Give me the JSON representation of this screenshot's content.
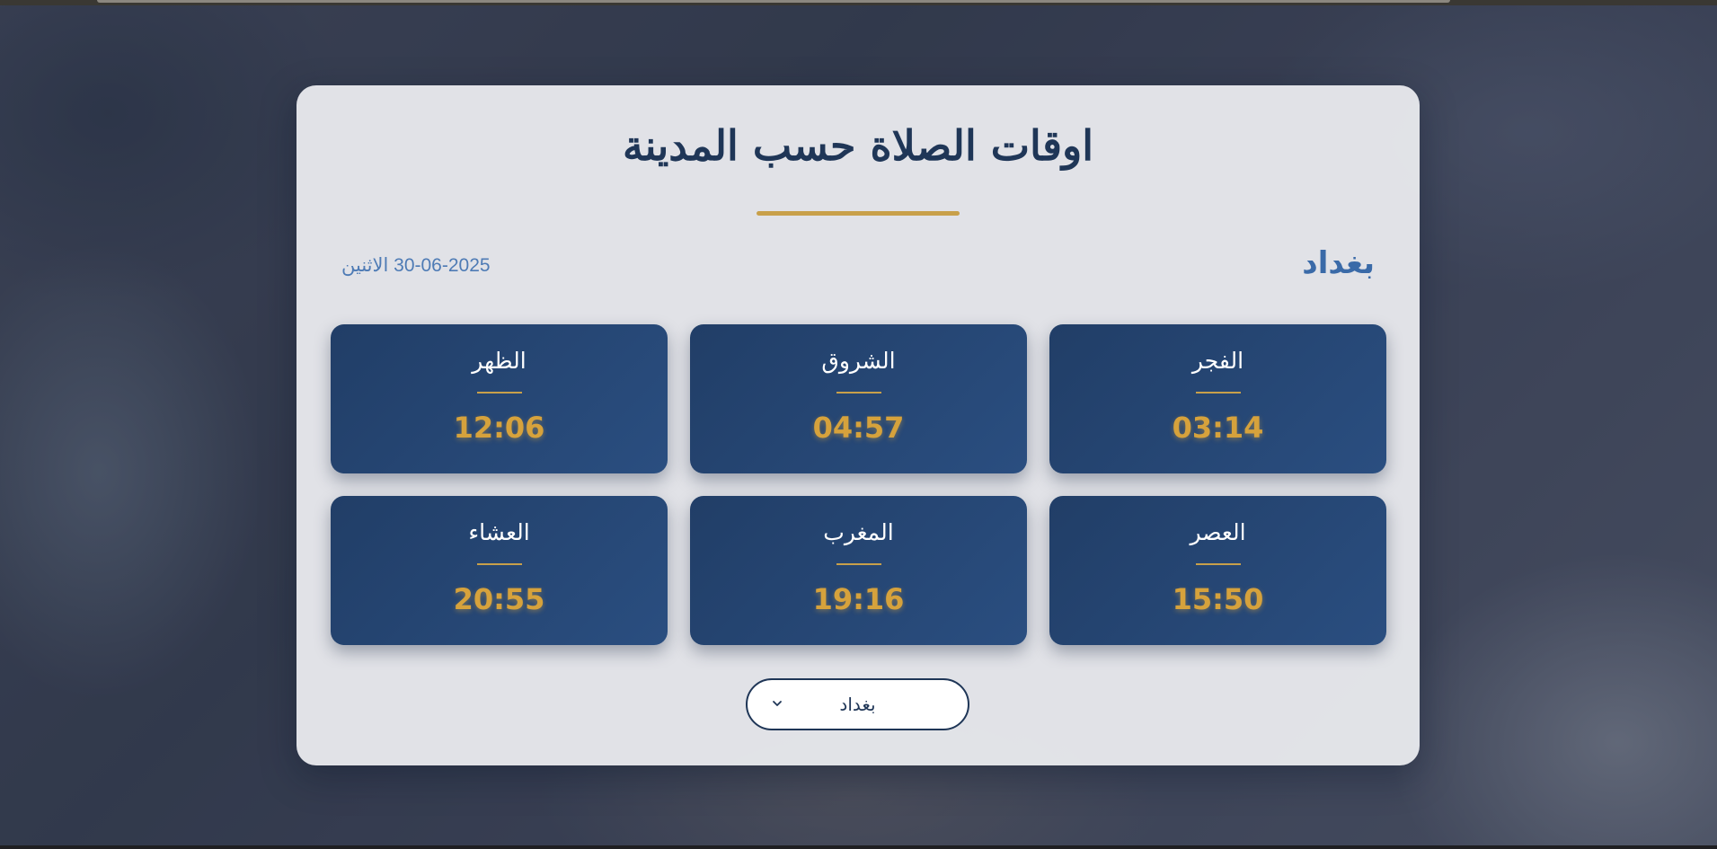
{
  "page": {
    "title": "اوقات الصلاة حسب المدينة"
  },
  "location": {
    "city": "بغداد",
    "date": "30-06-2025 الاثنين"
  },
  "prayers": [
    {
      "name": "الفجر",
      "time": "03:14"
    },
    {
      "name": "الشروق",
      "time": "04:57"
    },
    {
      "name": "الظهر",
      "time": "12:06"
    },
    {
      "name": "العصر",
      "time": "15:50"
    },
    {
      "name": "المغرب",
      "time": "19:16"
    },
    {
      "name": "العشاء",
      "time": "20:55"
    }
  ],
  "city_select": {
    "selected": "بغداد",
    "icon": "chevron-down-icon"
  },
  "colors": {
    "title": "#1f3657",
    "accent_gold": "#c8a04a",
    "time_gold": "#d6a23c",
    "card_blue": "#213e67",
    "city_blue": "#3a6aa8"
  }
}
